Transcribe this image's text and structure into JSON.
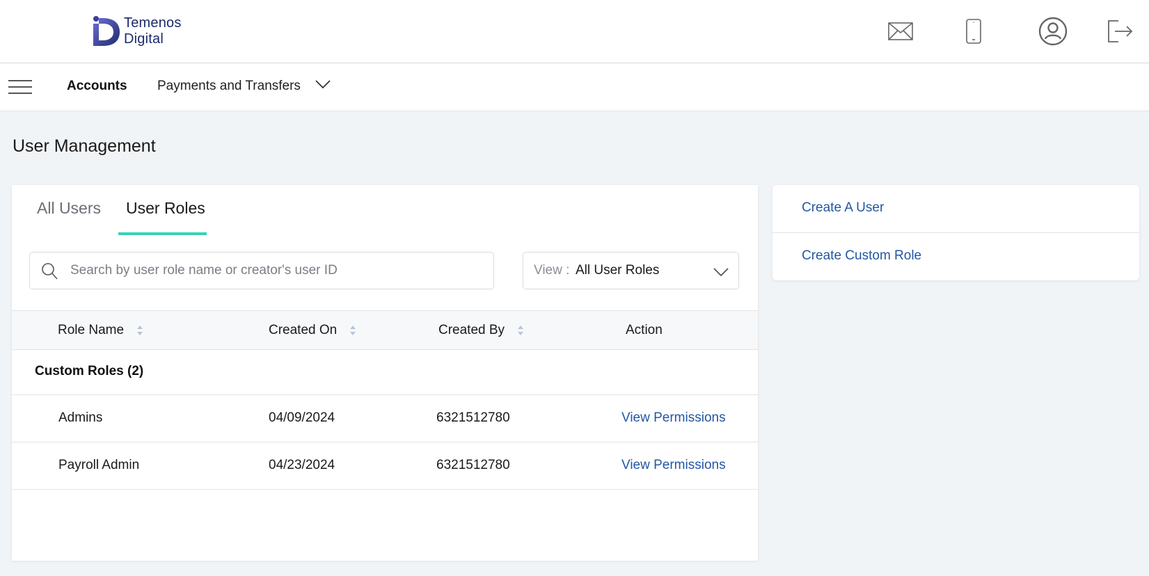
{
  "brand": {
    "line1": "Temenos",
    "line2": "Digital",
    "accent": "#1d2a6b"
  },
  "header_icons": [
    "mail-icon",
    "mobile-icon",
    "profile-icon",
    "logout-icon"
  ],
  "nav": {
    "accounts": "Accounts",
    "payments": "Payments and Transfers"
  },
  "page_title": "User Management",
  "tabs": [
    {
      "label": "All Users",
      "active": false
    },
    {
      "label": "User Roles",
      "active": true
    }
  ],
  "tab_accent": "#37d3b5",
  "search": {
    "placeholder": "Search by user role name or creator's user ID"
  },
  "view_filter": {
    "label": "View :",
    "value": "All User Roles"
  },
  "table": {
    "headers": {
      "role_name": "Role Name",
      "created_on": "Created On",
      "created_by": "Created By",
      "action": "Action"
    },
    "group_label": "Custom Roles (2)",
    "rows": [
      {
        "role_name": "Admins",
        "created_on": "04/09/2024",
        "created_by": "6321512780",
        "action": "View Permissions"
      },
      {
        "role_name": "Payroll Admin",
        "created_on": "04/23/2024",
        "created_by": "6321512780",
        "action": "View Permissions"
      }
    ]
  },
  "side_actions": {
    "create_user": "Create A User",
    "create_role": "Create Custom Role"
  },
  "link_color": "#2356a4"
}
